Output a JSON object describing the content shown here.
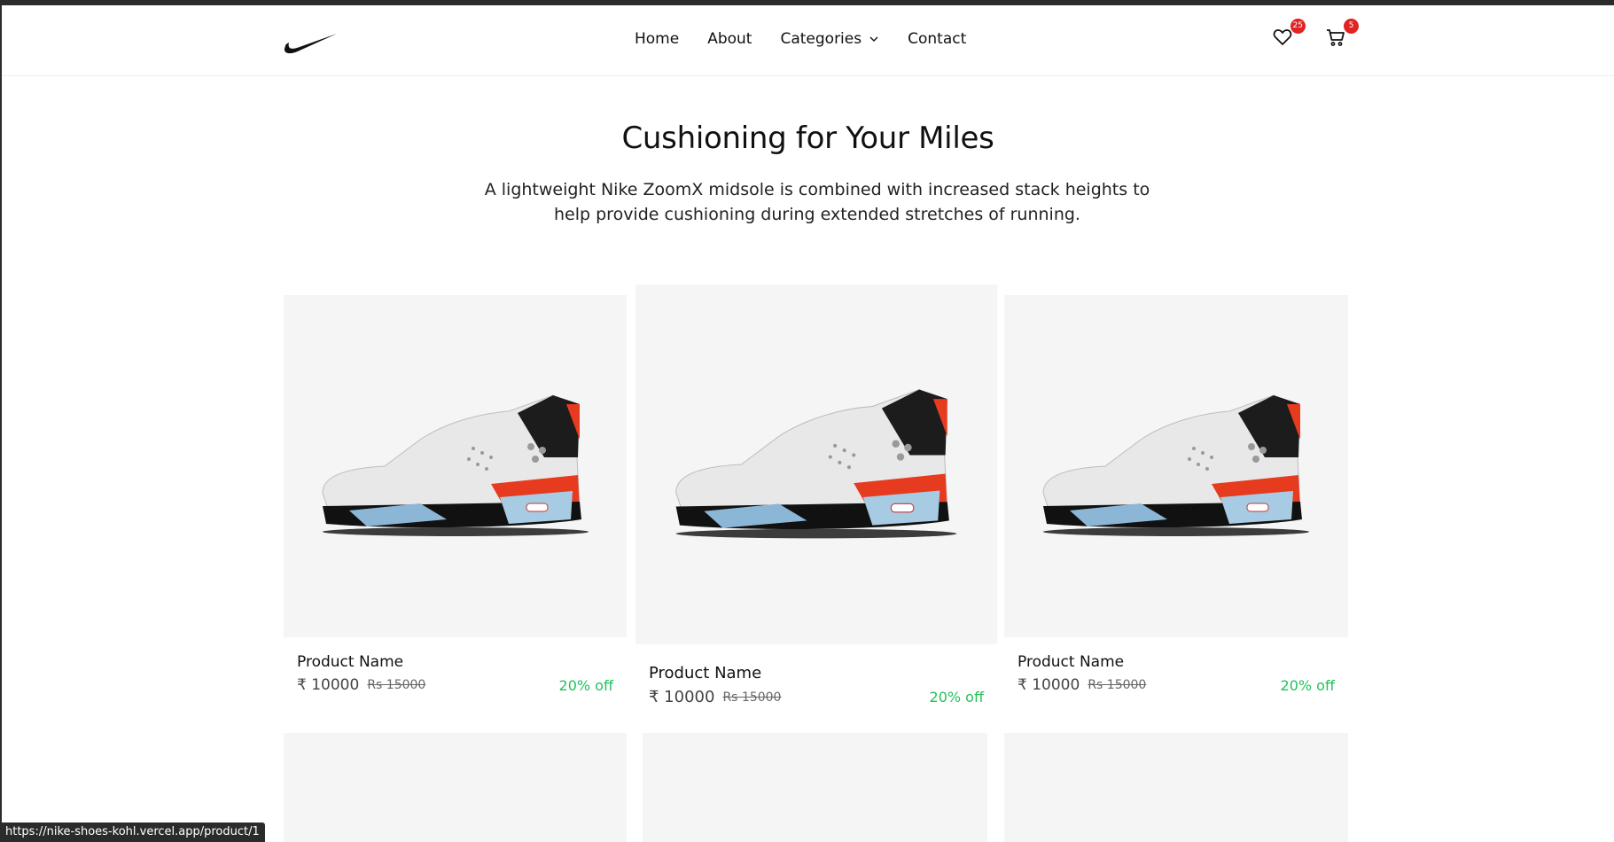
{
  "header": {
    "nav": [
      "Home",
      "About",
      "Categories",
      "Contact"
    ],
    "wishlist_count": "25",
    "cart_count": "5"
  },
  "hero": {
    "title": "Cushioning for Your Miles",
    "subtitle": "A lightweight Nike ZoomX midsole is combined with increased stack heights to help provide cushioning during extended stretches of running."
  },
  "products": [
    {
      "name": "Product Name",
      "price": "₹ 10000",
      "old_price": "Rs 15000",
      "discount": "20% off"
    },
    {
      "name": "Product Name",
      "price": "₹ 10000",
      "old_price": "Rs 15000",
      "discount": "20% off"
    },
    {
      "name": "Product Name",
      "price": "₹ 10000",
      "old_price": "Rs 15000",
      "discount": "20% off"
    }
  ],
  "status_bar": {
    "url": "https://nike-shoes-kohl.vercel.app/product/1"
  },
  "colors": {
    "discount": "#23c15a",
    "badge": "#e02424",
    "card_bg": "#f5f5f5"
  }
}
